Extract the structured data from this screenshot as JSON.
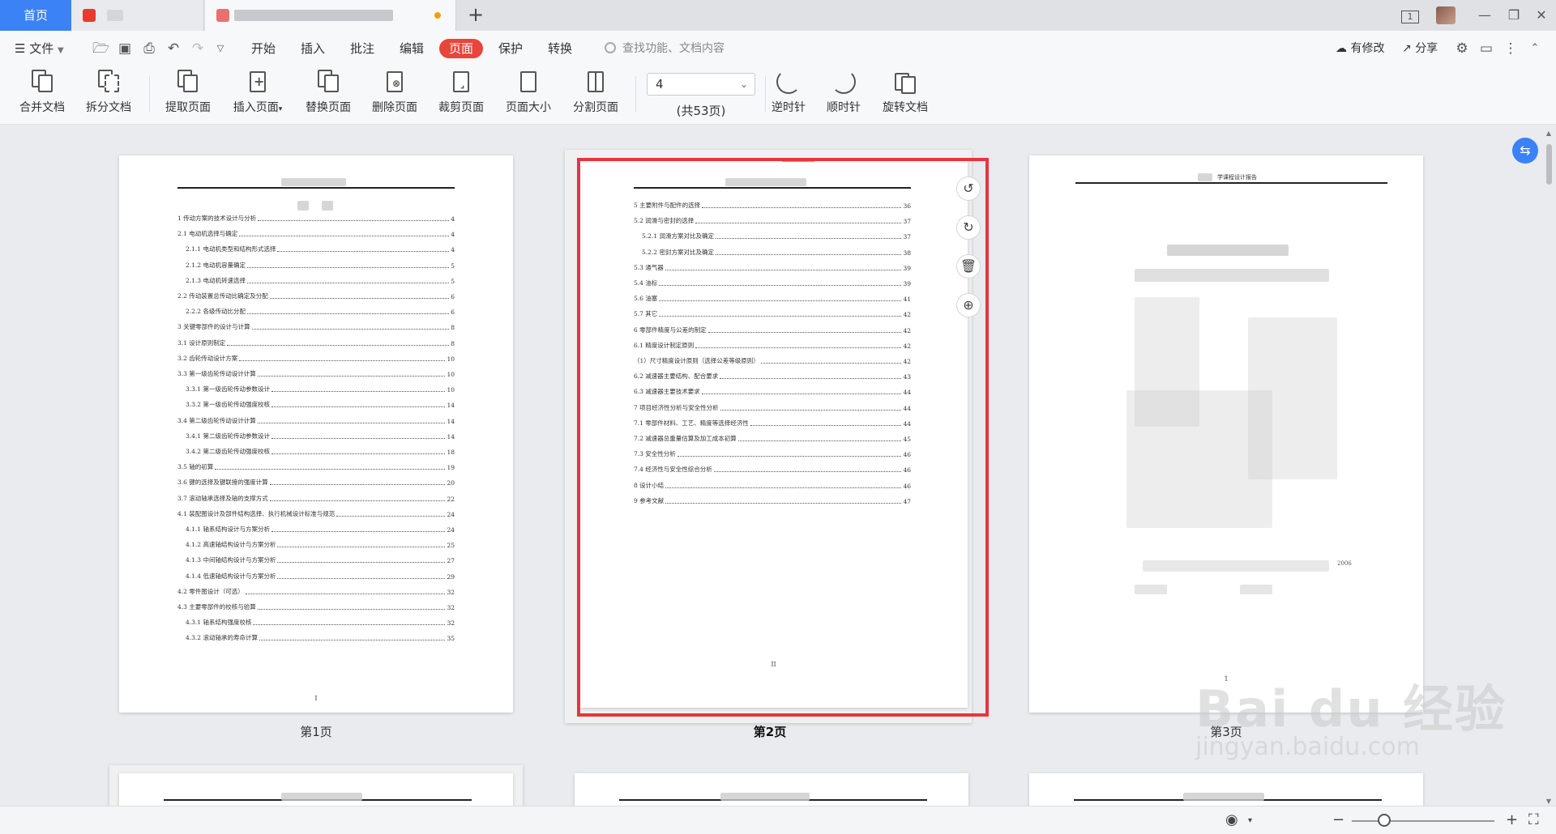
{
  "tabs": {
    "home": "首页"
  },
  "window": {
    "page_indicator": "1"
  },
  "menu": {
    "file": "文件",
    "items": [
      "开始",
      "插入",
      "批注",
      "编辑",
      "页面",
      "保护",
      "转换"
    ],
    "active": "页面",
    "search_placeholder": "查找功能、文档内容",
    "changes": "有修改",
    "share": "分享"
  },
  "ribbon": {
    "merge": "合并文档",
    "split": "拆分文档",
    "extract": "提取页面",
    "insert": "插入页面",
    "replace": "替换页面",
    "delete": "删除页面",
    "crop": "裁剪页面",
    "size": "页面大小",
    "divide": "分割页面",
    "page_value": "4",
    "page_total": "(共53页)",
    "ccw": "逆时针",
    "cw": "顺时针",
    "rotate_doc": "旋转文档"
  },
  "pages": {
    "page1": {
      "label": "第1页",
      "page_number": "I",
      "toc": [
        {
          "t": "1 传动方案的技术设计与分析",
          "p": "4",
          "indent": 0
        },
        {
          "t": "2.1 电动机选择与确定",
          "p": "4",
          "indent": 0
        },
        {
          "t": "2.1.1 电动机类型和结构形式选择",
          "p": "4",
          "indent": 1
        },
        {
          "t": "2.1.2 电动机容量确定",
          "p": "5",
          "indent": 1
        },
        {
          "t": "2.1.3 电动机转速选择",
          "p": "5",
          "indent": 1
        },
        {
          "t": "2.2 传动装置总传动比确定及分配",
          "p": "6",
          "indent": 0
        },
        {
          "t": "2.2.2 各级传动比分配",
          "p": "6",
          "indent": 1
        },
        {
          "t": "3 关键零部件的设计与计算",
          "p": "8",
          "indent": 0
        },
        {
          "t": "3.1 设计原则制定",
          "p": "8",
          "indent": 0
        },
        {
          "t": "3.2 齿轮传动设计方案",
          "p": "10",
          "indent": 0
        },
        {
          "t": "3.3 第一级齿轮传动设计计算",
          "p": "10",
          "indent": 0
        },
        {
          "t": "3.3.1 第一级齿轮传动参数设计",
          "p": "10",
          "indent": 1
        },
        {
          "t": "3.3.2 第一级齿轮传动强度校核",
          "p": "14",
          "indent": 1
        },
        {
          "t": "3.4 第二级齿轮传动设计计算",
          "p": "14",
          "indent": 0
        },
        {
          "t": "3.4.1 第二级齿轮传动参数设计",
          "p": "14",
          "indent": 1
        },
        {
          "t": "3.4.2 第二级齿轮传动强度校核",
          "p": "18",
          "indent": 1
        },
        {
          "t": "3.5 轴的初算",
          "p": "19",
          "indent": 0
        },
        {
          "t": "3.6 键的选择及键联接的强度计算",
          "p": "20",
          "indent": 0
        },
        {
          "t": "3.7 滚动轴承选择及轴的支撑方式",
          "p": "22",
          "indent": 0
        },
        {
          "t": "4.1 装配图设计及部件结构选择、执行机械设计标准与规范",
          "p": "24",
          "indent": 0
        },
        {
          "t": "4.1.1 轴系结构设计与方案分析",
          "p": "24",
          "indent": 1
        },
        {
          "t": "4.1.2 高速轴结构设计与方案分析",
          "p": "25",
          "indent": 1
        },
        {
          "t": "4.1.3 中间轴结构设计与方案分析",
          "p": "27",
          "indent": 1
        },
        {
          "t": "4.1.4 低速轴结构设计与方案分析",
          "p": "29",
          "indent": 1
        },
        {
          "t": "4.2 零件图设计（可选）",
          "p": "32",
          "indent": 0
        },
        {
          "t": "4.3 主要零部件的校核与验算",
          "p": "32",
          "indent": 0
        },
        {
          "t": "4.3.1 轴系结构强度校核",
          "p": "32",
          "indent": 1
        },
        {
          "t": "4.3.2 滚动轴承的寿命计算",
          "p": "35",
          "indent": 1
        }
      ]
    },
    "page2": {
      "label": "第2页",
      "page_number": "II",
      "toc": [
        {
          "t": "5 主要附件与配件的选择",
          "p": "36",
          "indent": 0
        },
        {
          "t": "5.2 润滑与密封的选择",
          "p": "37",
          "indent": 0
        },
        {
          "t": "5.2.1 润滑方案对比及确定",
          "p": "37",
          "indent": 1
        },
        {
          "t": "5.2.2 密封方案对比及确定",
          "p": "38",
          "indent": 1
        },
        {
          "t": "5.3 通气器",
          "p": "39",
          "indent": 0
        },
        {
          "t": "5.4 油标",
          "p": "39",
          "indent": 0
        },
        {
          "t": "5.6 油塞",
          "p": "41",
          "indent": 0
        },
        {
          "t": "5.7 其它",
          "p": "42",
          "indent": 0
        },
        {
          "t": "6 零部件精度与公差的制定",
          "p": "42",
          "indent": 0
        },
        {
          "t": "6.1 精度设计制定原则",
          "p": "42",
          "indent": 0
        },
        {
          "t": "（1）尺寸精度设计原则（选择公差等级原则）",
          "p": "42",
          "indent": 0
        },
        {
          "t": "6.2 减速器主要结构、配合要求",
          "p": "43",
          "indent": 0
        },
        {
          "t": "6.3 减速器主要技术要求",
          "p": "44",
          "indent": 0
        },
        {
          "t": "7 项目经济性分析与安全性分析",
          "p": "44",
          "indent": 0
        },
        {
          "t": "7.1 零部件材料、工艺、精度等选择经济性",
          "p": "44",
          "indent": 0
        },
        {
          "t": "7.2 减速器总重量估算及加工成本初算",
          "p": "45",
          "indent": 0
        },
        {
          "t": "7.3 安全性分析",
          "p": "46",
          "indent": 0
        },
        {
          "t": "7.4 经济性与安全性综合分析",
          "p": "46",
          "indent": 0
        },
        {
          "t": "8 设计小结",
          "p": "46",
          "indent": 0
        },
        {
          "t": "9 参考文献",
          "p": "47",
          "indent": 0
        }
      ]
    },
    "page3": {
      "label": "第3页",
      "header": "学课程设计报告",
      "year": "2006",
      "page_number": "1"
    }
  },
  "side_tools": [
    "rotate-ccw-icon",
    "rotate-cw-icon",
    "delete-icon",
    "add-icon"
  ],
  "watermark": {
    "brand": "Bai du 经验",
    "url": "jingyan.baidu.com"
  },
  "colors": {
    "accent_red": "#e8453c",
    "selection_red": "#e8353b",
    "home_tab_blue": "#3b82f6"
  }
}
